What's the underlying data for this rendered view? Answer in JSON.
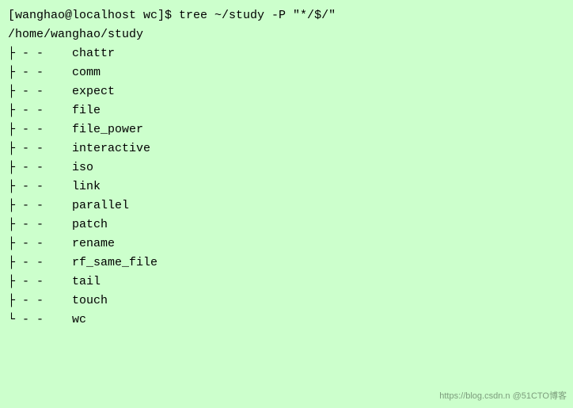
{
  "terminal": {
    "background": "#ccffcc",
    "prompt_line": "[wanghao@localhost wc]$ tree ~/study -P \"*/$/\"",
    "root_dir": "/home/wanghao/study",
    "entries": [
      "├ - -    chattr",
      "├ - -    comm",
      "├ - -    expect",
      "├ - -    file",
      "├ - -    file_power",
      "├ - -    interactive",
      "├ - -    iso",
      "├ - -    link",
      "├ - -    parallel",
      "├ - -    patch",
      "├ - -    rename",
      "├ - -    rf_same_file",
      "├ - -    tail",
      "├ - -    touch",
      "└ - -    wc"
    ],
    "watermark": "https://blog.csdn.n @51CTO博客"
  }
}
